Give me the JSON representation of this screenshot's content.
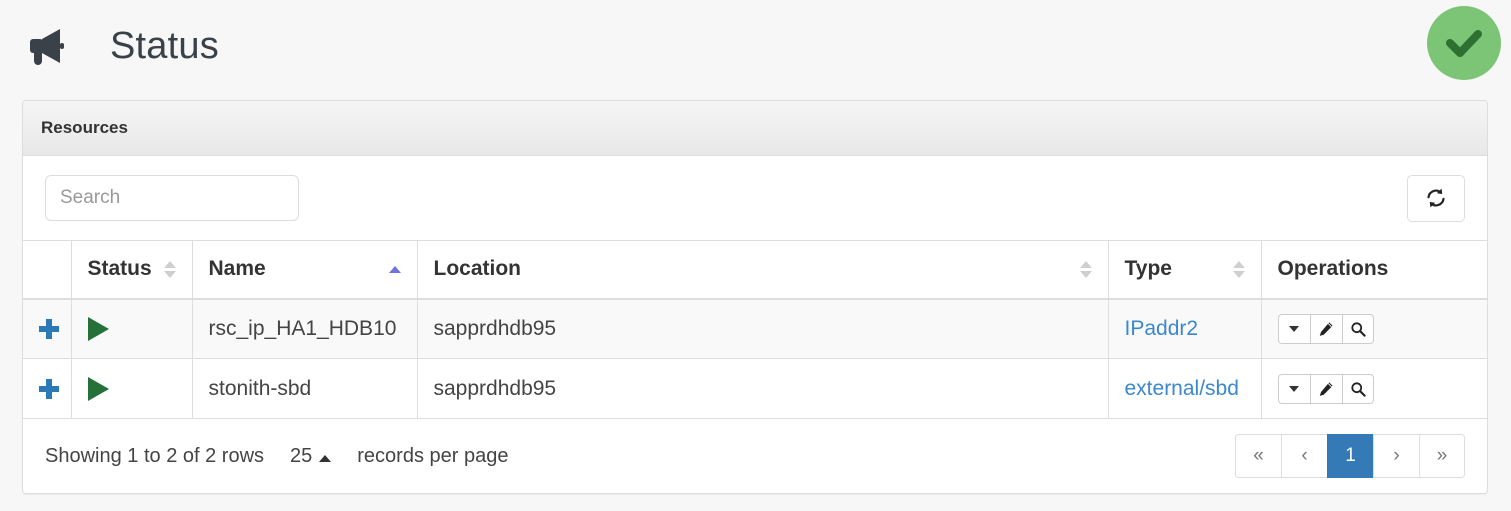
{
  "header": {
    "title": "Status",
    "icon": "bullhorn-icon",
    "status_badge_icon": "check-circle-icon",
    "status_badge_color": "#7cc576",
    "status_badge_check_color": "#2e7031"
  },
  "panel": {
    "title": "Resources"
  },
  "toolbar": {
    "search_placeholder": "Search",
    "search_value": "",
    "refresh_icon": "refresh-icon"
  },
  "table": {
    "columns": [
      {
        "label": "",
        "sortable": false,
        "sort": "none"
      },
      {
        "label": "Status",
        "sortable": true,
        "sort": "none"
      },
      {
        "label": "Name",
        "sortable": true,
        "sort": "asc"
      },
      {
        "label": "Location",
        "sortable": true,
        "sort": "none"
      },
      {
        "label": "Type",
        "sortable": true,
        "sort": "none"
      },
      {
        "label": "Operations",
        "sortable": false,
        "sort": "none"
      }
    ],
    "rows": [
      {
        "expand_icon": "plus-icon",
        "status_icon": "play-icon",
        "status_color": "#26703a",
        "name": "rsc_ip_HA1_HDB10",
        "location": "sapprdhdb95",
        "type": "IPaddr2",
        "operations": [
          "caret-down-icon",
          "pencil-icon",
          "magnifier-icon"
        ]
      },
      {
        "expand_icon": "plus-icon",
        "status_icon": "play-icon",
        "status_color": "#26703a",
        "name": "stonith-sbd",
        "location": "sapprdhdb95",
        "type": "external/sbd",
        "operations": [
          "caret-down-icon",
          "pencil-icon",
          "magnifier-icon"
        ]
      }
    ]
  },
  "footer": {
    "showing_text": "Showing 1 to 2 of 2 rows",
    "page_size": "25",
    "records_label": "records per page",
    "pagination": {
      "first": "«",
      "prev": "‹",
      "pages": [
        "1"
      ],
      "active_page": "1",
      "next": "›",
      "last": "»"
    }
  },
  "colors": {
    "accent_blue": "#337ab7",
    "link_blue": "#3b88cf",
    "plus_blue": "#2b7ab8",
    "sort_active": "#6f72d6",
    "success_green": "#7cc576"
  }
}
